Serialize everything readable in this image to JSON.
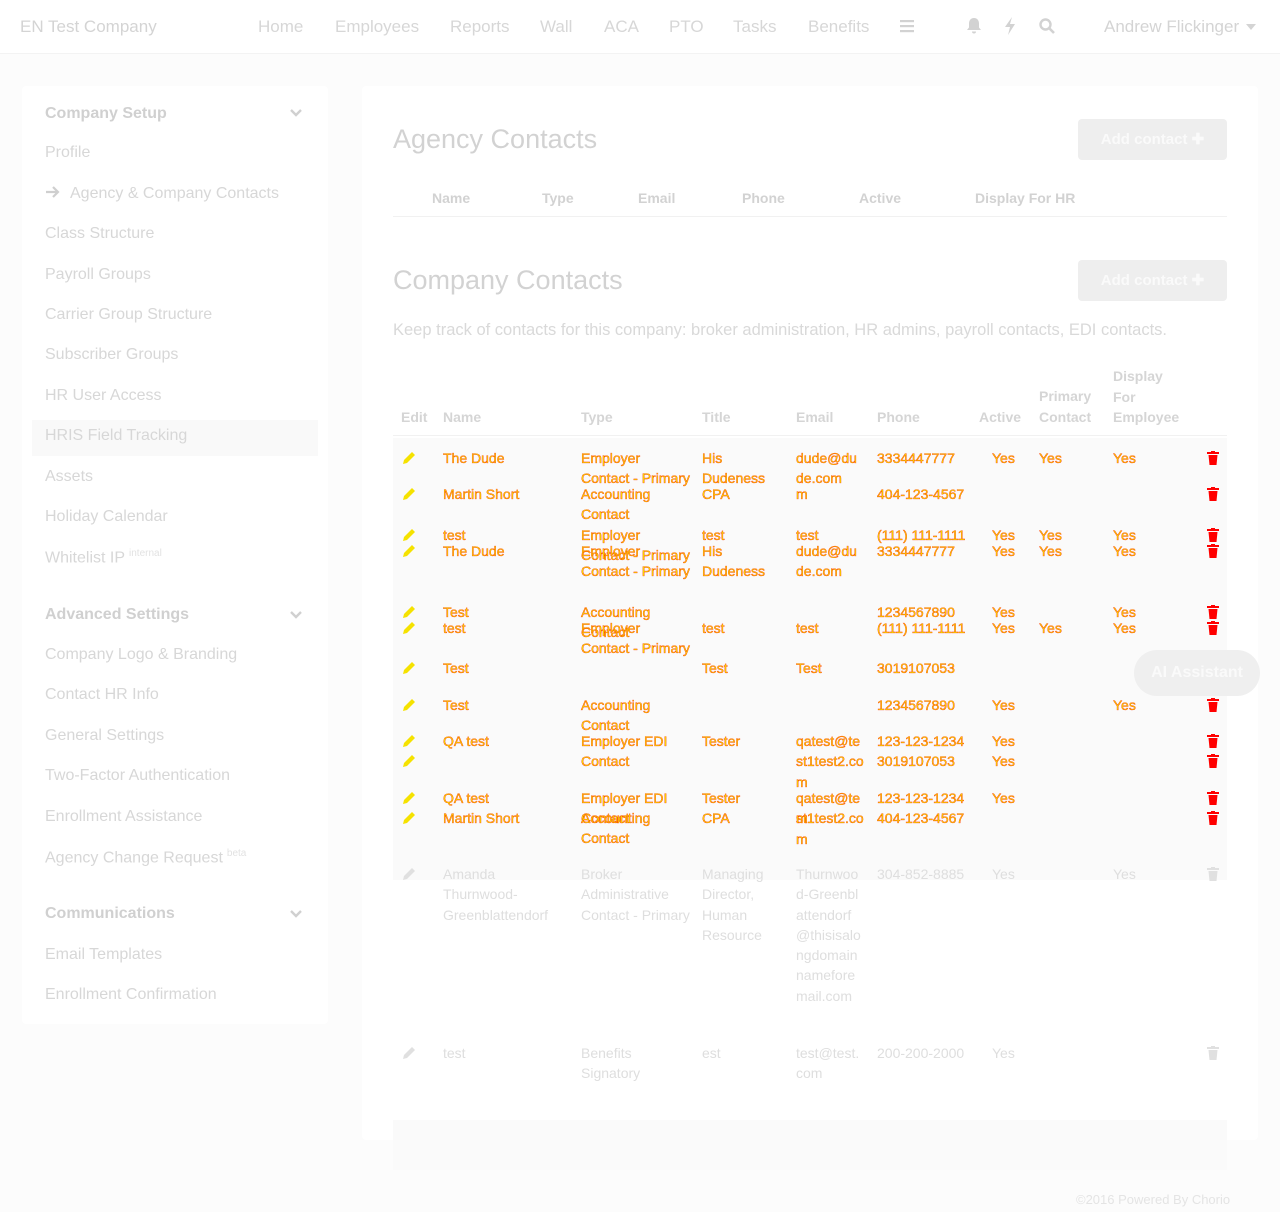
{
  "header": {
    "company": "EN Test Company",
    "nav": [
      "Home",
      "Employees",
      "Reports",
      "Wall",
      "ACA",
      "PTO",
      "Tasks",
      "Benefits"
    ],
    "icons": [
      "menu-icon",
      "bell-icon",
      "bolt-icon",
      "search-icon"
    ],
    "user": "Andrew Flickinger"
  },
  "sidebar": {
    "sections": [
      {
        "title": "Company Setup",
        "items": [
          "Profile",
          "Agency & Company Contacts",
          "Class Structure",
          "Payroll Groups",
          "Carrier Group Structure",
          "Subscriber Groups",
          "HR User Access",
          "HRIS Field Tracking",
          "Assets",
          "Holiday Calendar",
          "Whitelist IP"
        ],
        "whitelist_badge": "internal"
      },
      {
        "title": "Advanced Settings",
        "items": [
          "Company Logo & Branding",
          "Contact HR Info",
          "General Settings",
          "Two-Factor Authentication",
          "Enrollment Assistance",
          "Agency Change Request"
        ],
        "agency_badge": "beta"
      },
      {
        "title": "Communications",
        "items": [
          "Email Templates",
          "Enrollment Confirmation"
        ]
      }
    ]
  },
  "agency": {
    "title": "Agency Contacts",
    "add_label": "Add contact",
    "columns": [
      "Name",
      "Type",
      "Email",
      "Phone",
      "Active",
      "Display For HR"
    ]
  },
  "company": {
    "title": "Company Contacts",
    "add_label": "Add contact",
    "description": "Keep track of contacts for this company: broker administration, HR admins, payroll contacts, EDI contacts.",
    "columns": {
      "edit": "Edit",
      "name": "Name",
      "type": "Type",
      "title": "Title",
      "email": "Email",
      "phone": "Phone",
      "active": "Active",
      "primary_l1": "Primary",
      "primary_l2": "Contact",
      "display_l1": "Display",
      "display_l2": "For",
      "display_l3": "Employee"
    },
    "rows": [
      {
        "name": "The Dude",
        "type": "Employer Contact - Primary",
        "title": "His Dudeness",
        "email": "dude@dude.com",
        "phone": "3334447777",
        "active": "Yes",
        "primary": "Yes",
        "display": "Yes",
        "glitch": true
      },
      {
        "name": "Martin Short",
        "type": "Accounting Contact",
        "title": "CPA",
        "email": "m",
        "phone": "404-123-4567",
        "active": "",
        "primary": "",
        "display": "",
        "glitch": true
      },
      {
        "name": "test",
        "type": "Employer Contact - Primary",
        "title": "test",
        "email": "test",
        "phone": "(111) 111-1111",
        "active": "Yes",
        "primary": "Yes",
        "display": "Yes",
        "glitch": true
      },
      {
        "name": "The Dude",
        "type": "Employer Contact - Primary",
        "title": "His Dudeness",
        "email": "dude@dude.com",
        "phone": "3334447777",
        "active": "Yes",
        "primary": "Yes",
        "display": "Yes",
        "glitch": true
      },
      {
        "name": "Test",
        "type": "Accounting Contact",
        "title": "",
        "email": "",
        "phone": "1234567890",
        "active": "Yes",
        "primary": "",
        "display": "Yes",
        "glitch": true
      },
      {
        "name": "test",
        "type": "Employer Contact - Primary",
        "title": "test",
        "email": "test",
        "phone": "(111) 111-1111",
        "active": "Yes",
        "primary": "Yes",
        "display": "Yes",
        "glitch": true
      },
      {
        "name": "Test",
        "type": "",
        "title": "Test",
        "email": "Test",
        "phone": "3019107053",
        "active": "",
        "primary": "",
        "display": "",
        "glitch": true
      },
      {
        "name": "Test",
        "type": "Accounting Contact",
        "title": "",
        "email": "",
        "phone": "1234567890",
        "active": "Yes",
        "primary": "",
        "display": "Yes",
        "glitch": true
      },
      {
        "name": "QA test",
        "type": "Employer EDI Contact",
        "title": "Tester",
        "email": "qatest@test1test2.com",
        "phone": "123-123-1234",
        "active": "Yes",
        "primary": "",
        "display": "",
        "glitch": true
      },
      {
        "name": "",
        "type": "",
        "title": "",
        "email": "",
        "phone": "3019107053",
        "active": "Yes",
        "primary": "",
        "display": "",
        "glitch": true
      },
      {
        "name": "QA test",
        "type": "Employer EDI Contact",
        "title": "Tester",
        "email": "qatest@test1test2.com",
        "phone": "123-123-1234",
        "active": "Yes",
        "primary": "",
        "display": "",
        "glitch": true
      },
      {
        "name": "Martin Short",
        "type": "Accounting Contact",
        "title": "CPA",
        "email": "m",
        "phone": "404-123-4567",
        "active": "",
        "primary": "",
        "display": "",
        "glitch": true
      },
      {
        "name": "Amanda Thurnwood-Greenblattendorf",
        "type": "Broker Administrative Contact - Primary",
        "title": "Managing Director, Human Resource",
        "email": "Thurnwood-Greenblattendorf@thisisalongdomainnamefore mail.com",
        "phone": "304-852-8885",
        "active": "Yes",
        "primary": "",
        "display": "Yes",
        "glitch": false
      },
      {
        "name": "test",
        "type": "Benefits Signatory",
        "title": "est",
        "email": "test@test.com",
        "phone": "200-200-2000",
        "active": "Yes",
        "primary": "",
        "display": "",
        "glitch": false
      }
    ]
  },
  "assistant": {
    "label": "AI Assistant"
  },
  "footer": {
    "text": "©2016 Powered By Chorio"
  },
  "colors": {
    "glitch_fill": "#f5e200",
    "glitch_stroke": "#ff2200",
    "icon_red": "#ff0000"
  }
}
